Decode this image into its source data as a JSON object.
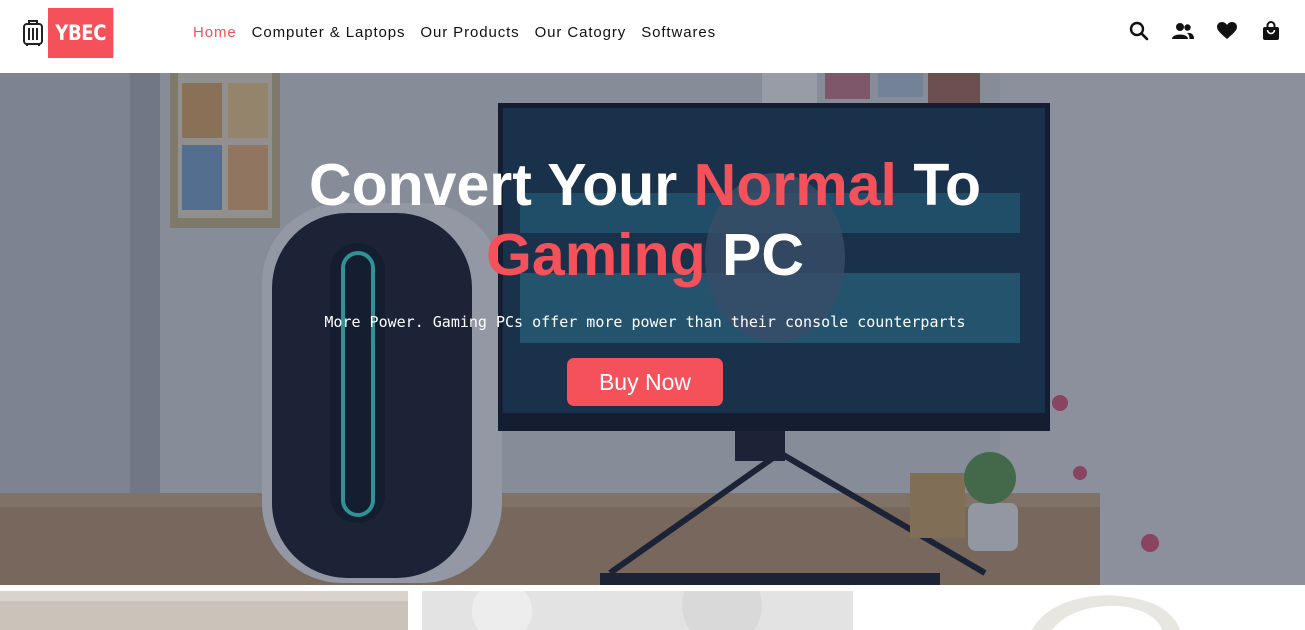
{
  "brand": {
    "logo_text": "YBEC",
    "accent": "#f4515a"
  },
  "nav": {
    "items": [
      {
        "label": "Home",
        "active": true
      },
      {
        "label": "Computer & Laptops",
        "active": false
      },
      {
        "label": "Our Products",
        "active": false
      },
      {
        "label": "Our Catogry",
        "active": false
      },
      {
        "label": "Softwares",
        "active": false
      }
    ]
  },
  "header_icons": [
    "search-icon",
    "account-icon",
    "wishlist-heart-icon",
    "shopping-bag-icon"
  ],
  "hero": {
    "title_line1": {
      "before": "Convert Your ",
      "accent": "Normal",
      "after": " To"
    },
    "title_line2": {
      "before": "",
      "accent": "Gaming",
      "after": " PC"
    },
    "subtitle": "More Power. Gaming PCs offer more power than their console counterparts",
    "button_label": "Buy Now"
  },
  "featured_cards": [
    "product-card-1",
    "product-card-2",
    "product-card-3"
  ]
}
